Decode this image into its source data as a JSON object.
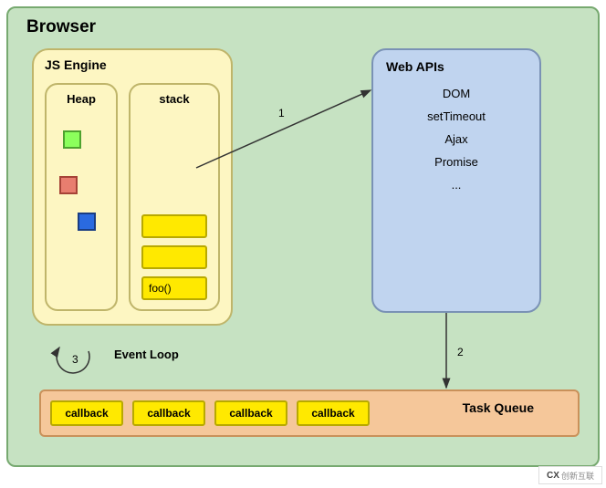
{
  "browser": {
    "title": "Browser"
  },
  "js_engine": {
    "title": "JS Engine",
    "heap": {
      "title": "Heap"
    },
    "stack": {
      "title": "stack",
      "items": [
        "",
        "",
        "foo()"
      ]
    }
  },
  "web_apis": {
    "title": "Web APIs",
    "items": [
      "DOM",
      "setTimeout",
      "Ajax",
      "Promise",
      "..."
    ]
  },
  "event_loop": {
    "label": "Event Loop"
  },
  "task_queue": {
    "title": "Task Queue",
    "callbacks": [
      "callback",
      "callback",
      "callback",
      "callback"
    ]
  },
  "arrows": {
    "one": "1",
    "two": "2",
    "three": "3"
  },
  "watermark": {
    "brand": "CX",
    "text": "创新互联"
  }
}
